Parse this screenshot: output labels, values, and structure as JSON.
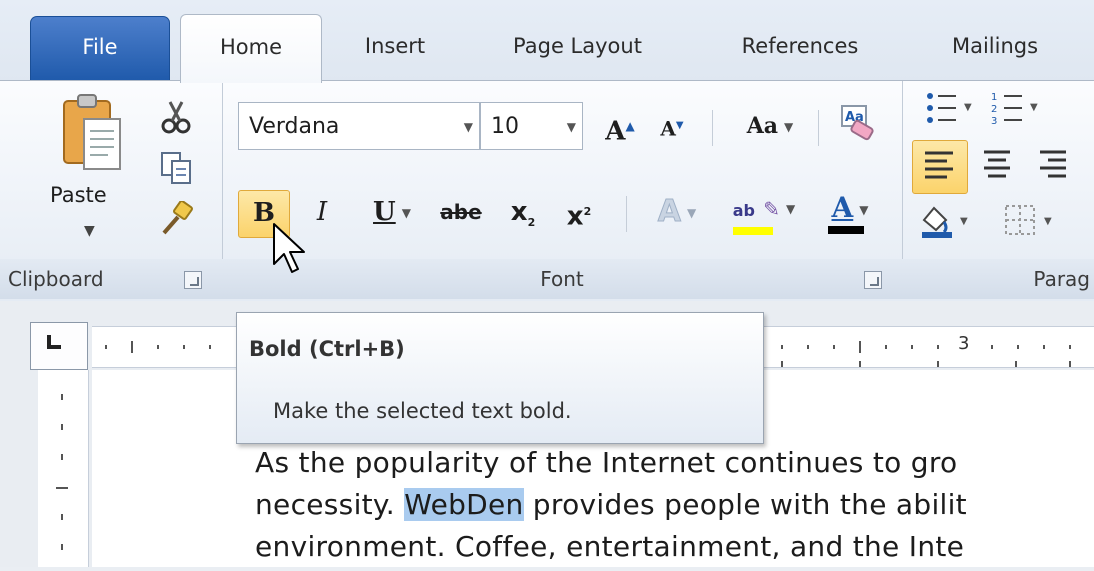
{
  "tabs": {
    "file": "File",
    "home": "Home",
    "insert": "Insert",
    "page_layout": "Page Layout",
    "references": "References",
    "mailings": "Mailings"
  },
  "clipboard": {
    "paste_label": "Paste",
    "group_label": "Clipboard"
  },
  "font": {
    "font_name": "Verdana",
    "font_size": "10",
    "group_label": "Font",
    "change_case_label": "Aa",
    "clear_format_label": "A",
    "grow_label": "A",
    "shrink_label": "A",
    "bold_label": "B",
    "italic_label": "I",
    "underline_label": "U",
    "strike_label": "abe",
    "subscript_label": "x",
    "superscript_label": "x",
    "effects_label": "A",
    "highlight_label": "ab",
    "font_color_label": "A",
    "highlight_color": "#ffff00",
    "font_color": "#000000"
  },
  "paragraph": {
    "group_label": "Parag"
  },
  "ruler": {
    "number": "3"
  },
  "tooltip": {
    "title": "Bold (Ctrl+B)",
    "description": "Make the selected text bold."
  },
  "document": {
    "line1": "As the popularity of the Internet continues to gro",
    "line2_before": "necessity. ",
    "line2_selected": "WebDen",
    "line2_after": " provides people with the abilit",
    "line3": "environment. Coffee, entertainment, and the Inte"
  }
}
